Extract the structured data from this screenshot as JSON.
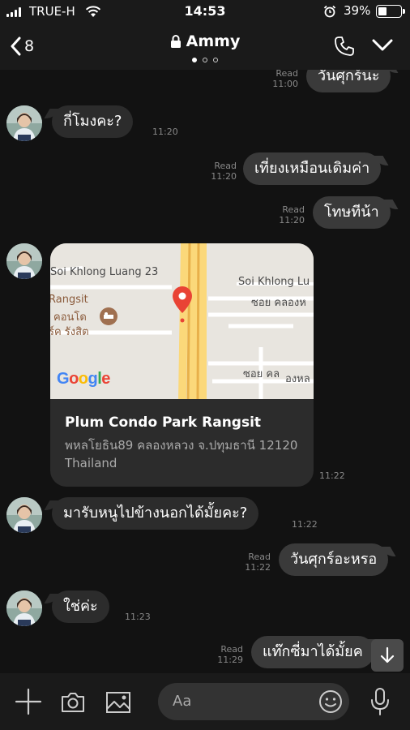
{
  "status_bar": {
    "carrier": "TRUE-H",
    "time": "14:53",
    "battery": "39%"
  },
  "nav": {
    "back_count": "8",
    "title": "Ammy",
    "page_dots": 3,
    "active_dot": 0
  },
  "messages": [
    {
      "dir": "out",
      "text": "วันศุกร์นะ",
      "read": "Read",
      "time": "11:00"
    },
    {
      "dir": "in",
      "text": "กี่โมงคะ?",
      "time": "11:20"
    },
    {
      "dir": "out",
      "text": "เที่ยงเหมือนเดิมค่า",
      "read": "Read",
      "time": "11:20"
    },
    {
      "dir": "out",
      "text": "โทษทีน้า",
      "read": "Read",
      "time": "11:20"
    },
    {
      "dir": "in",
      "text": "มารับหนูไปข้างนอกได้มั้ยคะ?",
      "time": "11:22"
    },
    {
      "dir": "out",
      "text": "วันศุกร์อะหรอ",
      "read": "Read",
      "time": "11:22"
    },
    {
      "dir": "in",
      "text": "ใช่ค่ะ",
      "time": "11:23"
    },
    {
      "dir": "out",
      "text": "แท๊กซี่มาได้มั้ยค",
      "read": "Read",
      "time": "11:29"
    }
  ],
  "location": {
    "name": "Plum Condo Park Rangsit",
    "address": "พหลโยธิน89 คลองหลวง จ.ปทุมธานี 12120 Thailand",
    "time": "11:22",
    "map_labels": {
      "road1": "Soi Khlong Luang 23",
      "road2": "Soi Khlong Lu",
      "thai_road1": "ซอย คลองห",
      "thai_road2": "ซอย คล",
      "thai_road3": "องหล",
      "place_en": "Rangsit",
      "place_th1": "คอนโด",
      "place_th2": "ร์ค รังสิต",
      "google": "Google"
    }
  },
  "input": {
    "placeholder": "Aa"
  },
  "colors": {
    "background": "#121212",
    "bubble_in": "#2c2c2c",
    "bubble_out": "#3a3a3a",
    "pin": "#e94335"
  },
  "icons": [
    "back-chevron-icon",
    "lock-icon",
    "phone-icon",
    "chevron-down-icon",
    "plus-icon",
    "camera-icon",
    "image-icon",
    "emoji-icon",
    "microphone-icon",
    "arrow-down-icon",
    "location-pin-icon"
  ]
}
